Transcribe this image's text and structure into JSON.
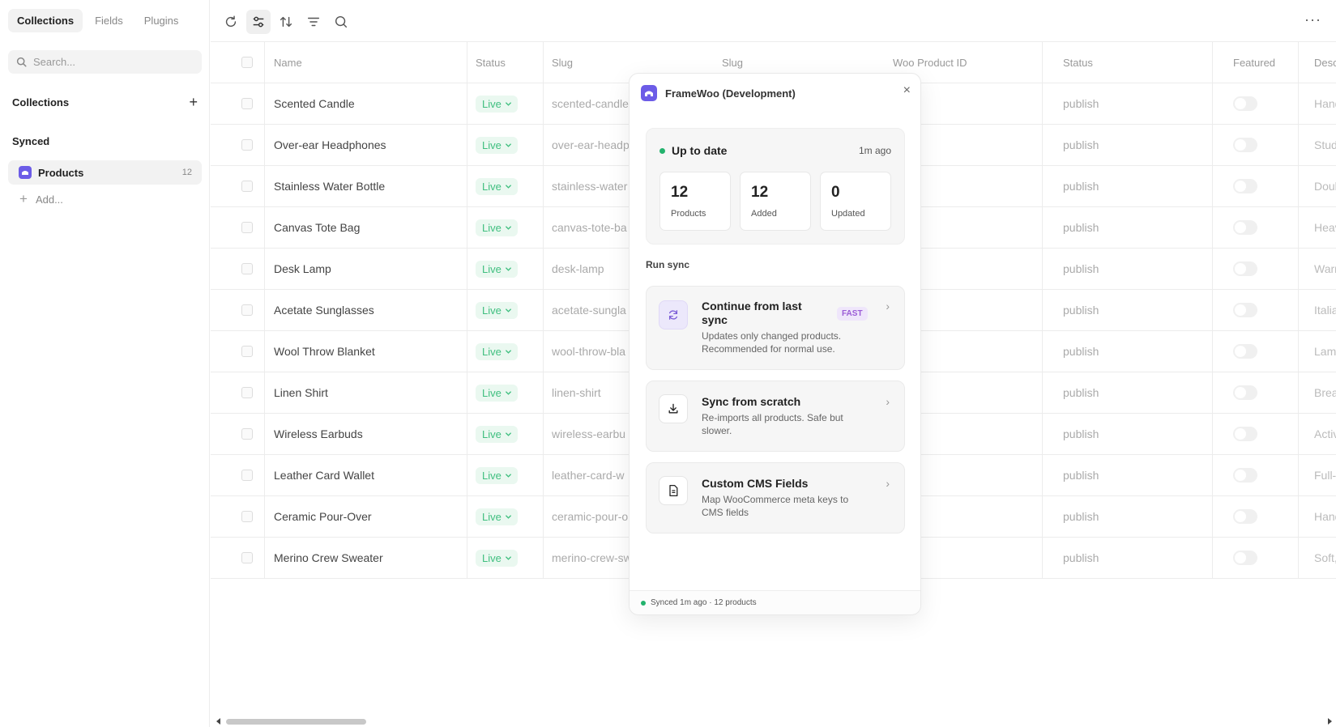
{
  "sidebar": {
    "tabs": [
      "Collections",
      "Fields",
      "Plugins"
    ],
    "search_placeholder": "Search...",
    "collections_heading": "Collections",
    "synced_heading": "Synced",
    "collection_item": {
      "name": "Products",
      "count": "12"
    },
    "add_label": "Add..."
  },
  "table": {
    "headers": [
      "Name",
      "Status",
      "Slug",
      "Slug",
      "Woo Product ID",
      "Status",
      "Featured",
      "Desc"
    ],
    "status_label": "Live",
    "rows": [
      {
        "name": "Scented Candle",
        "slug": "scented-candle",
        "status2": "publish",
        "desc": "Hand"
      },
      {
        "name": "Over-ear Headphones",
        "slug": "over-ear-headp",
        "status2": "publish",
        "desc": "Stud"
      },
      {
        "name": "Stainless Water Bottle",
        "slug": "stainless-water",
        "status2": "publish",
        "desc": "Doub"
      },
      {
        "name": "Canvas Tote Bag",
        "slug": "canvas-tote-ba",
        "status2": "publish",
        "desc": "Heav"
      },
      {
        "name": "Desk Lamp",
        "slug": "desk-lamp",
        "status2": "publish",
        "desc": "Warr"
      },
      {
        "name": "Acetate Sunglasses",
        "slug": "acetate-sungla",
        "status2": "publish",
        "desc": "Italia"
      },
      {
        "name": "Wool Throw Blanket",
        "slug": "wool-throw-bla",
        "status2": "publish",
        "desc": "Lamb"
      },
      {
        "name": "Linen Shirt",
        "slug": "linen-shirt",
        "status2": "publish",
        "desc": "Brea"
      },
      {
        "name": "Wireless Earbuds",
        "slug": "wireless-earbu",
        "status2": "publish",
        "desc": "Activ"
      },
      {
        "name": "Leather Card Wallet",
        "slug": "leather-card-w",
        "status2": "publish",
        "desc": "Full-"
      },
      {
        "name": "Ceramic Pour-Over",
        "slug": "ceramic-pour-o",
        "status2": "publish",
        "desc": "Hand"
      },
      {
        "name": "Merino Crew Sweater",
        "slug": "merino-crew-sw",
        "status2": "publish",
        "desc": "Soft,"
      }
    ]
  },
  "popup": {
    "title": "FrameWoo (Development)",
    "close": "×",
    "status_title": "Up to date",
    "status_time": "1m ago",
    "stats": [
      {
        "num": "12",
        "label": "Products"
      },
      {
        "num": "12",
        "label": "Added"
      },
      {
        "num": "0",
        "label": "Updated"
      }
    ],
    "run_sync": "Run sync",
    "options": [
      {
        "title": "Continue from last sync",
        "desc": "Updates only changed products. Recommended for normal use.",
        "badge": "FAST"
      },
      {
        "title": "Sync from scratch",
        "desc": "Re-imports all products. Safe but slower."
      },
      {
        "title": "Custom CMS Fields",
        "desc": "Map WooCommerce meta keys to CMS fields"
      }
    ],
    "footer": "Synced 1m ago · 12 products"
  },
  "colors": {
    "accent": "#6c5ce7",
    "live_green": "#3fbf7f",
    "sync_dot": "#23b26d"
  }
}
